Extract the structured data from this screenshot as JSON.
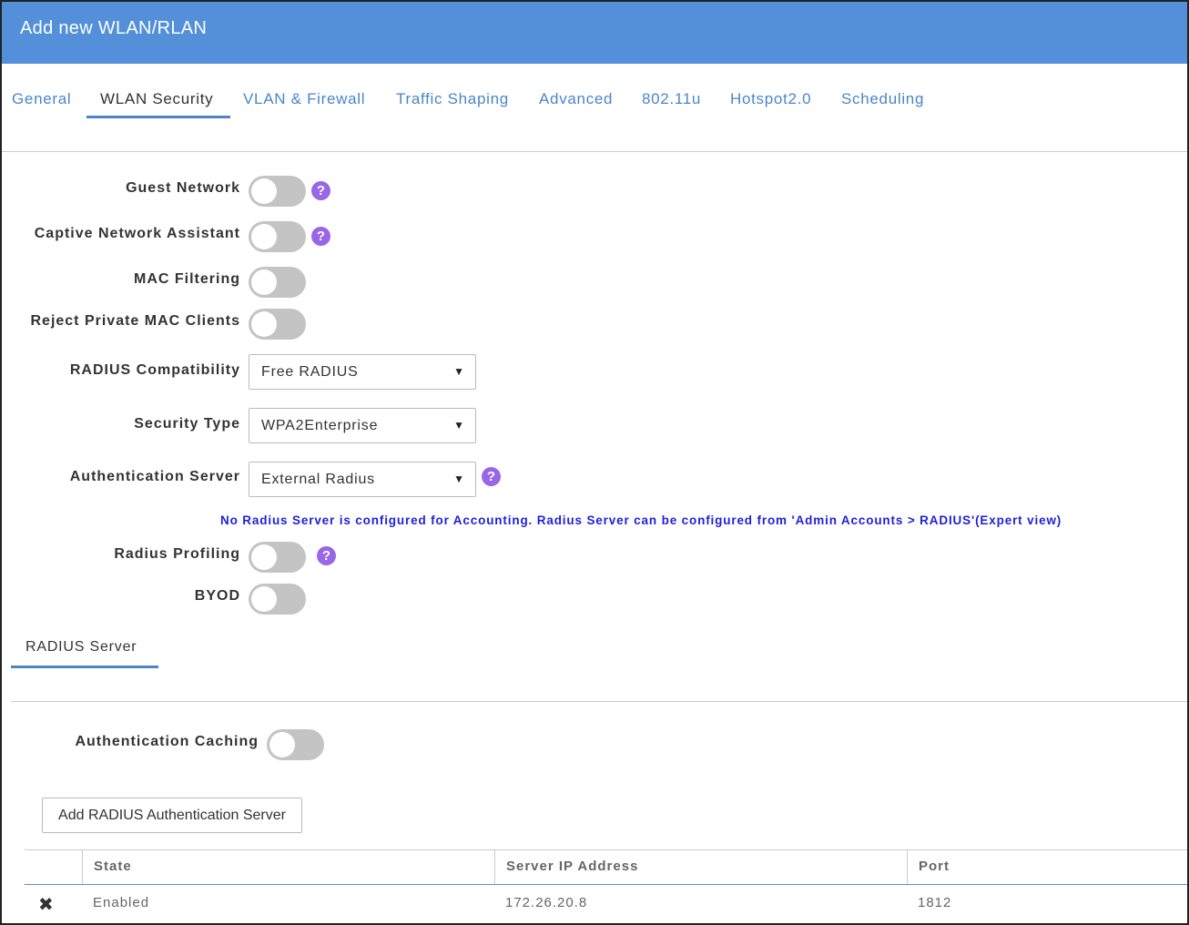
{
  "header": {
    "title": "Add new WLAN/RLAN"
  },
  "tabs": [
    {
      "label": "General"
    },
    {
      "label": "WLAN Security"
    },
    {
      "label": "VLAN & Firewall"
    },
    {
      "label": "Traffic Shaping"
    },
    {
      "label": "Advanced"
    },
    {
      "label": "802.11u"
    },
    {
      "label": "Hotspot2.0"
    },
    {
      "label": "Scheduling"
    }
  ],
  "active_tab": "WLAN Security",
  "form": {
    "guest_network": {
      "label": "Guest Network",
      "enabled": false
    },
    "captive_network_assistant": {
      "label": "Captive Network Assistant",
      "enabled": false
    },
    "mac_filtering": {
      "label": "MAC Filtering",
      "enabled": false
    },
    "reject_private_mac": {
      "label": "Reject Private MAC Clients",
      "enabled": false
    },
    "radius_compatibility": {
      "label": "RADIUS Compatibility",
      "value": "Free RADIUS"
    },
    "security_type": {
      "label": "Security Type",
      "value": "WPA2Enterprise"
    },
    "authentication_server": {
      "label": "Authentication Server",
      "value": "External Radius"
    },
    "notice": "No Radius Server is configured for Accounting. Radius Server can be configured from 'Admin Accounts > RADIUS'(Expert view)",
    "radius_profiling": {
      "label": "Radius Profiling",
      "enabled": false
    },
    "byod": {
      "label": "BYOD",
      "enabled": false
    }
  },
  "subtab": {
    "label": "RADIUS Server"
  },
  "auth_caching": {
    "label": "Authentication Caching",
    "enabled": false
  },
  "add_server_button": "Add RADIUS Authentication Server",
  "table": {
    "columns": [
      "State",
      "Server IP Address",
      "Port"
    ],
    "rows": [
      {
        "state": "Enabled",
        "ip": "172.26.20.8",
        "port": "1812"
      }
    ]
  },
  "icons": {
    "help": "question-circle-icon",
    "dropdown": "caret-down-icon",
    "delete": "close-x-icon"
  },
  "colors": {
    "header": "#5390d9",
    "accent": "#4a86c8",
    "help": "#9966e6",
    "notice": "#1f1fdc",
    "toggle_off": "#c4c4c4"
  }
}
